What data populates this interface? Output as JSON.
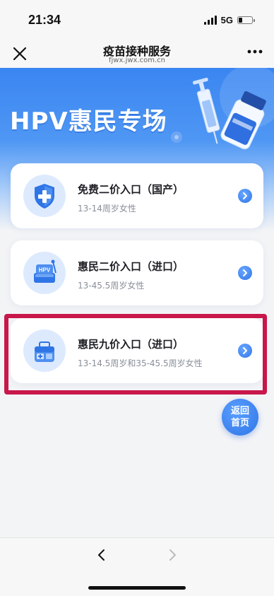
{
  "status_bar": {
    "time": "21:34",
    "network": "5G"
  },
  "nav": {
    "title": "疫苗接种服务",
    "subtitle": "fjwx.jwx.com.cn"
  },
  "banner": {
    "title": "HPV惠民专场"
  },
  "cards": [
    {
      "title": "免费二价入口（国产）",
      "subtitle": "13-14周岁女性",
      "icon": "shield-cross-icon"
    },
    {
      "title": "惠民二价入口（进口）",
      "subtitle": "13-45.5周岁女性",
      "icon": "hpv-vaccine-icon"
    },
    {
      "title": "惠民九价入口（进口）",
      "subtitle": "13-14.5周岁和35-45.5周岁女性",
      "icon": "medical-kit-icon"
    }
  ],
  "home_button": {
    "line1": "返回",
    "line2": "首页"
  },
  "colors": {
    "accent": "#3a86f2",
    "highlight": "#c8174a"
  }
}
